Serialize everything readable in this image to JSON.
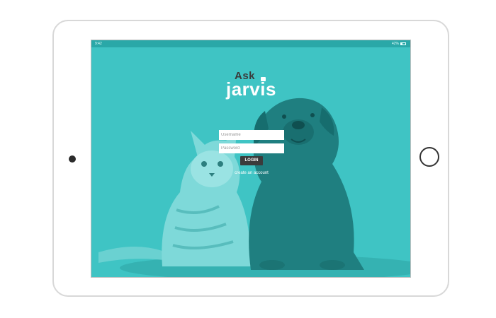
{
  "statusbar": {
    "time": "9:42",
    "battery": "42%"
  },
  "logo": {
    "ask": "Ask",
    "jarvis": "jarvis"
  },
  "login_form": {
    "username_placeholder": "Username",
    "password_placeholder": "Password",
    "login_label": "LOGIN",
    "create_account_label": "create an account"
  },
  "colors": {
    "screen_bg": "#3fc4c4",
    "statusbar_bg": "#2aa8a8",
    "button_bg": "#3b3b3b"
  },
  "icons": [
    "battery-icon",
    "camera-icon",
    "home-button-icon"
  ]
}
